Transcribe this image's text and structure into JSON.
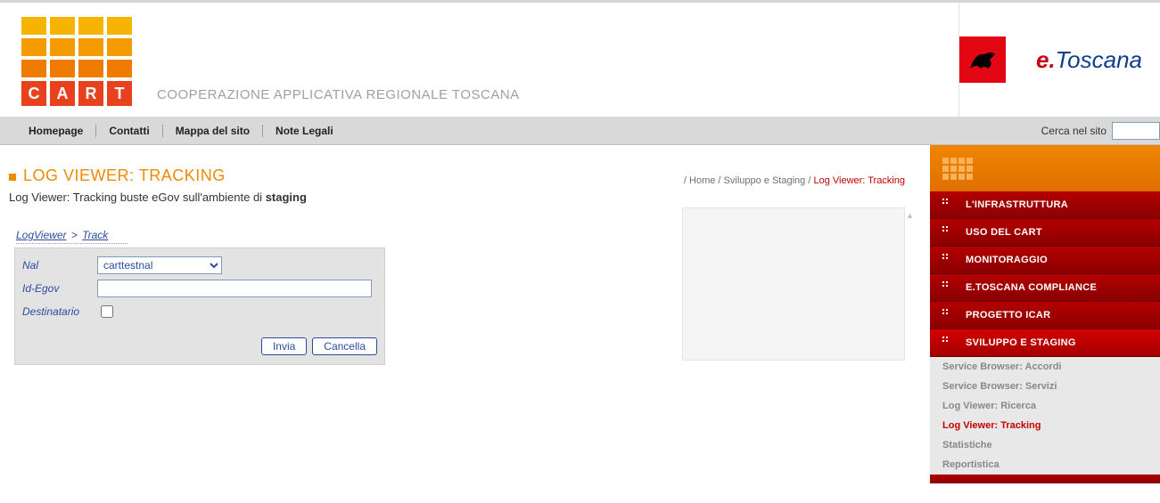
{
  "header": {
    "logo_letters": [
      "C",
      "A",
      "R",
      "T"
    ],
    "subtitle": "COOPERAZIONE APPLICATIVA REGIONALE TOSCANA",
    "etoscana_prefix": "e.",
    "etoscana_name": "Toscana"
  },
  "navbar": {
    "items": [
      "Homepage",
      "Contatti",
      "Mappa del sito",
      "Note Legali"
    ],
    "search_label": "Cerca nel sito",
    "search_value": ""
  },
  "page": {
    "title": "LOG VIEWER: TRACKING",
    "description_prefix": "Log Viewer: Tracking buste eGov sull'ambiente di ",
    "description_bold": "staging"
  },
  "breadcrumb": {
    "items": [
      "Home",
      "Sviluppo e Staging"
    ],
    "current": "Log Viewer: Tracking"
  },
  "mini_breadcrumb": {
    "a": "LogViewer",
    "b": "Track"
  },
  "form": {
    "labels": {
      "nal": "Nal",
      "idegov": "Id-Egov",
      "dest": "Destinatario"
    },
    "nal_value": "carttestnal",
    "idegov_value": "",
    "dest_checked": false,
    "buttons": {
      "submit": "Invia",
      "cancel": "Cancella"
    }
  },
  "sidebar": {
    "items": [
      {
        "label": "L'INFRASTRUTTURA"
      },
      {
        "label": "USO DEL CART"
      },
      {
        "label": "MONITORAGGIO"
      },
      {
        "label": "E.TOSCANA COMPLIANCE"
      },
      {
        "label": "PROGETTO ICAR"
      },
      {
        "label": "SVILUPPO E STAGING",
        "selected": true
      }
    ],
    "sub_items": [
      {
        "label": "Service Browser: Accordi"
      },
      {
        "label": "Service Browser: Servizi"
      },
      {
        "label": "Log Viewer: Ricerca"
      },
      {
        "label": "Log Viewer: Tracking",
        "active": true
      },
      {
        "label": "Statistiche"
      },
      {
        "label": "Reportistica"
      }
    ]
  }
}
